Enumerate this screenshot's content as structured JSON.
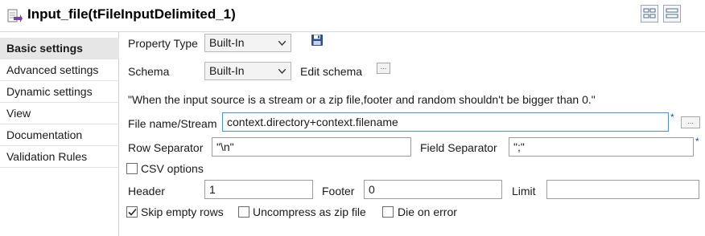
{
  "title": "Input_file(tFileInputDelimited_1)",
  "sidebar": {
    "items": [
      {
        "label": "Basic settings",
        "active": true
      },
      {
        "label": "Advanced settings",
        "active": false
      },
      {
        "label": "Dynamic settings",
        "active": false
      },
      {
        "label": "View",
        "active": false
      },
      {
        "label": "Documentation",
        "active": false
      },
      {
        "label": "Validation Rules",
        "active": false
      }
    ]
  },
  "form": {
    "property_type": {
      "label": "Property Type",
      "value": "Built-In"
    },
    "schema": {
      "label": "Schema",
      "value": "Built-In",
      "edit_label": "Edit schema",
      "edit_button": "..."
    },
    "note": "\"When the input source is a stream or a zip file,footer and random shouldn't be bigger than 0.\"",
    "file_name": {
      "label": "File name/Stream",
      "value": "context.directory+context.filename",
      "required_mark": "*",
      "browse_button": "..."
    },
    "row_separator": {
      "label": "Row Separator",
      "value": "\"\\n\""
    },
    "field_separator": {
      "label": "Field Separator",
      "value": "\";\"",
      "required_mark": "*"
    },
    "csv_options": {
      "label": "CSV options",
      "checked": false
    },
    "header": {
      "label": "Header",
      "value": "1"
    },
    "footer": {
      "label": "Footer",
      "value": "0"
    },
    "limit": {
      "label": "Limit",
      "value": ""
    },
    "skip_empty_rows": {
      "label": "Skip empty rows",
      "checked": true
    },
    "uncompress_zip": {
      "label": "Uncompress as zip file",
      "checked": false
    },
    "die_on_error": {
      "label": "Die on error",
      "checked": false
    }
  }
}
